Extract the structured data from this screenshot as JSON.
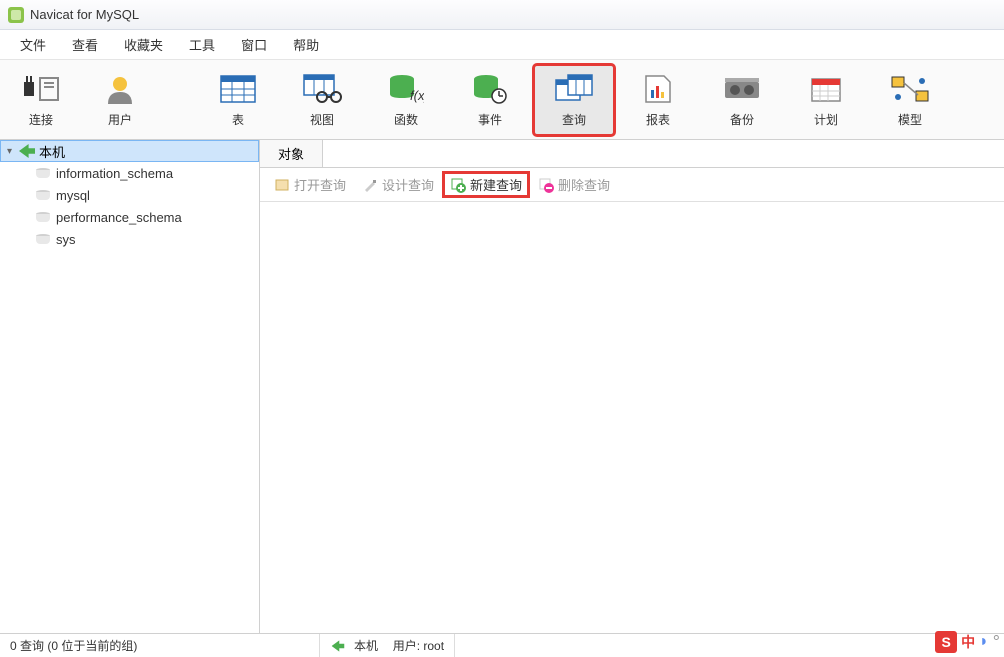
{
  "title": "Navicat for MySQL",
  "menu": {
    "file": "文件",
    "view": "查看",
    "favorites": "收藏夹",
    "tools": "工具",
    "window": "窗口",
    "help": "帮助"
  },
  "toolbar": {
    "connect": "连接",
    "user": "用户",
    "table": "表",
    "sqlview": "视图",
    "func": "函数",
    "event": "事件",
    "query": "查询",
    "report": "报表",
    "backup": "备份",
    "schedule": "计划",
    "model": "模型"
  },
  "tree": {
    "connection": "本机",
    "dbs": [
      "information_schema",
      "mysql",
      "performance_schema",
      "sys"
    ]
  },
  "tab": {
    "objects": "对象"
  },
  "actions": {
    "open": "打开查询",
    "design": "设计查询",
    "new": "新建查询",
    "delete": "删除查询"
  },
  "status": {
    "left": "0 查询 (0 位于当前的组)",
    "conn": "本机",
    "user": "用户: root"
  },
  "ime": {
    "logo": "S",
    "mode": "中"
  }
}
